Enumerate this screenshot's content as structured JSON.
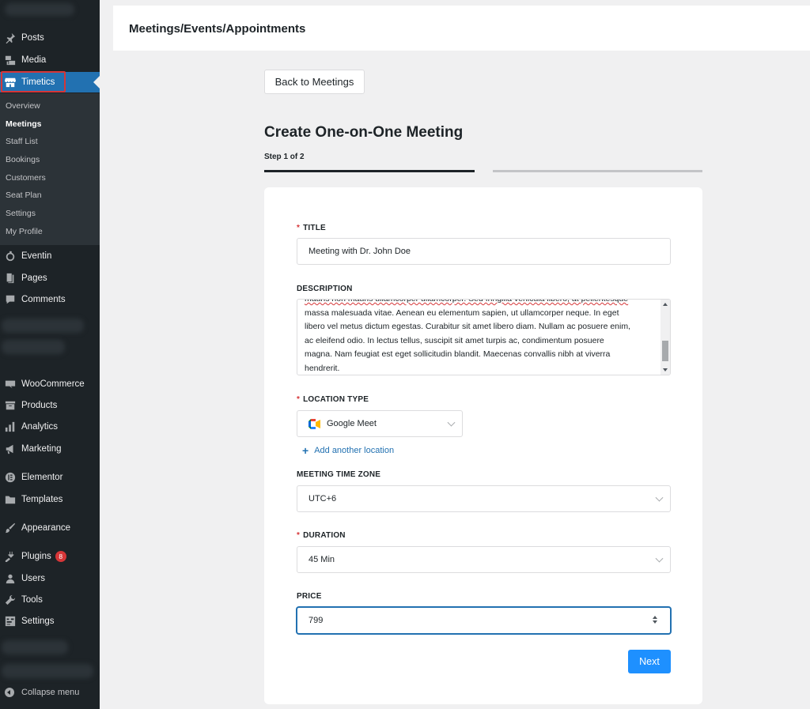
{
  "sidebar": {
    "items_top": [
      {
        "label": "Posts",
        "icon": "pin-icon"
      },
      {
        "label": "Media",
        "icon": "media-icon"
      },
      {
        "label": "Timetics",
        "icon": "store-icon"
      }
    ],
    "submenu": [
      "Overview",
      "Meetings",
      "Staff List",
      "Bookings",
      "Customers",
      "Seat Plan",
      "Settings",
      "My Profile"
    ],
    "items_mid": [
      {
        "label": "Eventin",
        "icon": "eventin-icon"
      },
      {
        "label": "Pages",
        "icon": "pages-icon"
      },
      {
        "label": "Comments",
        "icon": "comments-icon"
      }
    ],
    "items_bottom": [
      {
        "label": "WooCommerce",
        "icon": "woocommerce-icon"
      },
      {
        "label": "Products",
        "icon": "products-icon"
      },
      {
        "label": "Analytics",
        "icon": "analytics-icon"
      },
      {
        "label": "Marketing",
        "icon": "megaphone-icon"
      },
      {
        "label": "Elementor",
        "icon": "elementor-icon"
      },
      {
        "label": "Templates",
        "icon": "folder-icon"
      },
      {
        "label": "Appearance",
        "icon": "brush-icon"
      },
      {
        "label": "Plugins",
        "icon": "plugin-icon",
        "badge": "8"
      },
      {
        "label": "Users",
        "icon": "users-icon"
      },
      {
        "label": "Tools",
        "icon": "wrench-icon"
      },
      {
        "label": "Settings",
        "icon": "settings-icon"
      }
    ],
    "collapse_label": "Collapse menu"
  },
  "header": {
    "title": "Meetings/Events/Appointments"
  },
  "back_button": "Back to Meetings",
  "page_title": "Create One-on-One Meeting",
  "step_label": "Step 1 of 2",
  "form": {
    "title_label": "TITLE",
    "title_value": "Meeting with Dr. John Doe",
    "description_label": "DESCRIPTION",
    "description_lines": [
      "mauris non mauris ullamcorper ullamcorper. Sed fringilla vehicula libero, at pellentesque",
      "massa malesuada vitae. Aenean eu elementum sapien, ut ullamcorper neque. In eget",
      "libero vel metus dictum egestas. Curabitur sit amet libero diam. Nullam ac posuere enim,",
      "ac eleifend odio. In lectus tellus, suscipit sit amet turpis ac, condimentum posuere",
      "magna. Nam feugiat est eget sollicitudin blandit. Maecenas convallis nibh at viverra",
      "hendrerit."
    ],
    "location_label": "LOCATION TYPE",
    "location_value": "Google Meet",
    "add_location": "Add another location",
    "timezone_label": "MEETING TIME ZONE",
    "timezone_value": "UTC+6",
    "duration_label": "DURATION",
    "duration_value": "45 Min",
    "price_label": "PRICE",
    "price_value": "799",
    "required_marker": "*",
    "next_button": "Next"
  },
  "colors": {
    "sidebar_bg": "#1d2327",
    "accent": "#2271b1",
    "next_button": "#1e90ff",
    "required": "#d63638"
  }
}
